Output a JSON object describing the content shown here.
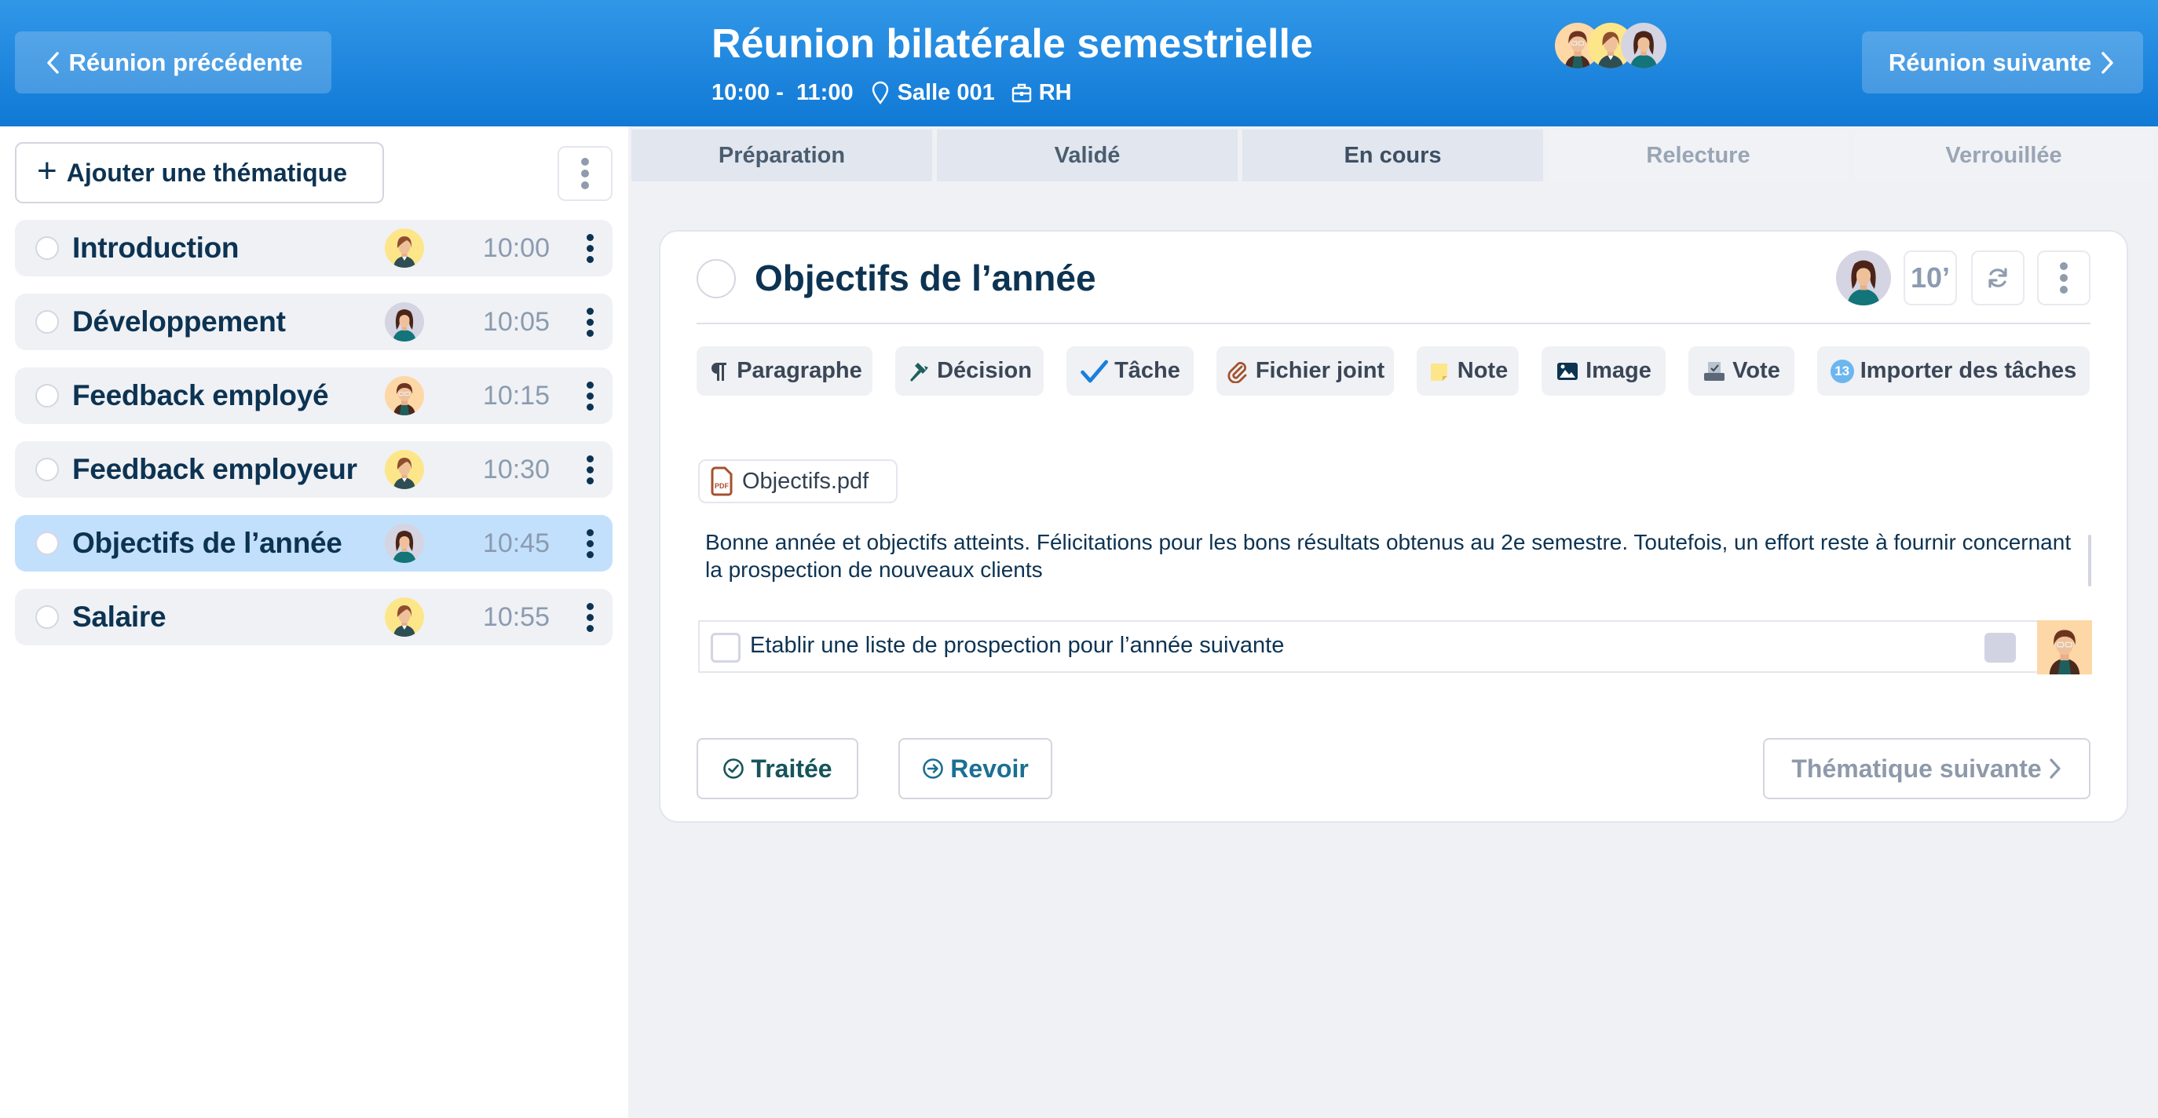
{
  "header": {
    "prev_label": "Réunion précédente",
    "next_label": "Réunion suivante",
    "title": "Réunion bilatérale semestrielle",
    "time_range": "10:00 -  11:00",
    "location": "Salle 001",
    "department": "RH",
    "participants": [
      {
        "name": "participant-1",
        "bg": "#fed7a6",
        "style": "glasses"
      },
      {
        "name": "participant-2",
        "bg": "#fde68a",
        "style": "short-hair"
      },
      {
        "name": "participant-3",
        "bg": "#d4d4e2",
        "style": "long-hair"
      }
    ]
  },
  "sidebar": {
    "add_label": "Ajouter une thématique",
    "topics": [
      {
        "label": "Introduction",
        "time": "10:00",
        "avatar": "short-hair",
        "avatar_bg": "#fde68a",
        "active": false
      },
      {
        "label": "Développement",
        "time": "10:05",
        "avatar": "long-hair",
        "avatar_bg": "#d4d4e2",
        "active": false
      },
      {
        "label": "Feedback employé",
        "time": "10:15",
        "avatar": "glasses",
        "avatar_bg": "#fed7a6",
        "active": false
      },
      {
        "label": "Feedback employeur",
        "time": "10:30",
        "avatar": "short-hair",
        "avatar_bg": "#fde68a",
        "active": false
      },
      {
        "label": "Objectifs de l’année",
        "time": "10:45",
        "avatar": "long-hair",
        "avatar_bg": "#d4d4e2",
        "active": true
      },
      {
        "label": "Salaire",
        "time": "10:55",
        "avatar": "short-hair",
        "avatar_bg": "#fde68a",
        "active": false
      }
    ]
  },
  "tabs": [
    {
      "label": "Préparation",
      "state": "done"
    },
    {
      "label": "Validé",
      "state": "done"
    },
    {
      "label": "En cours",
      "state": "current"
    },
    {
      "label": "Relecture",
      "state": "disabled"
    },
    {
      "label": "Verrouillée",
      "state": "disabled"
    }
  ],
  "card": {
    "title": "Objectifs de l’année",
    "duration": "10’",
    "toolbar": [
      {
        "label": "Paragraphe",
        "icon": "paragraph-icon"
      },
      {
        "label": "Décision",
        "icon": "gavel-icon"
      },
      {
        "label": "Tâche",
        "icon": "check-icon"
      },
      {
        "label": "Fichier joint",
        "icon": "paperclip-icon"
      },
      {
        "label": "Note",
        "icon": "sticky-note-icon"
      },
      {
        "label": "Image",
        "icon": "image-icon"
      },
      {
        "label": "Vote",
        "icon": "ballot-box-icon"
      },
      {
        "label": "Importer des tâches",
        "icon": "badge-count",
        "badge": "13"
      }
    ],
    "attachment": "Objectifs.pdf",
    "paragraph": "Bonne année et objectifs atteints. Félicitations pour les bons résultats obtenus au 2e semestre. Toutefois, un effort reste à fournir concernant la prospection de nouveaux clients",
    "task": {
      "label": "Etablir une liste de prospection pour l’année suivante",
      "checked": false
    },
    "buttons": {
      "done": "Traitée",
      "review": "Revoir",
      "next": "Thématique suivante"
    }
  },
  "colors": {
    "header_top": "#3197e7",
    "header_bottom": "#0f79d5",
    "primary_text": "#0d3352",
    "active_topic": "#c2e0fc",
    "muted": "#8b9bb0"
  }
}
